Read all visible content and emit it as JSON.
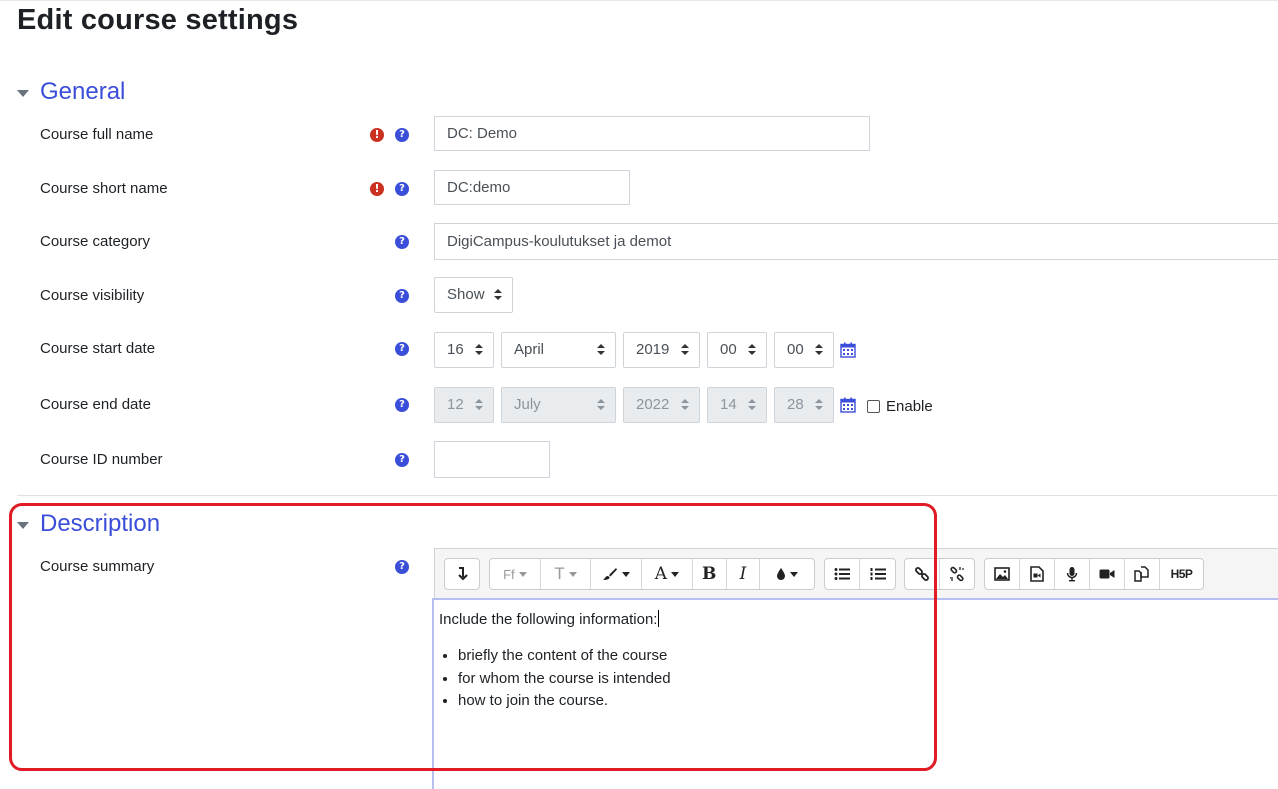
{
  "page_title": "Edit course settings",
  "sections": {
    "general": {
      "title": "General"
    },
    "description": {
      "title": "Description"
    }
  },
  "fields": {
    "full_name": {
      "label": "Course full name",
      "value": "DC: Demo"
    },
    "short_name": {
      "label": "Course short name",
      "value": "DC:demo"
    },
    "category": {
      "label": "Course category",
      "value": "DigiCampus-koulutukset ja demot"
    },
    "visibility": {
      "label": "Course visibility",
      "value": "Show"
    },
    "start_date": {
      "label": "Course start date",
      "day": "16",
      "month": "April",
      "year": "2019",
      "hour": "00",
      "minute": "00"
    },
    "end_date": {
      "label": "Course end date",
      "day": "12",
      "month": "July",
      "year": "2022",
      "hour": "14",
      "minute": "28",
      "enable_label": "Enable",
      "enabled": false
    },
    "id_number": {
      "label": "Course ID number",
      "value": ""
    },
    "summary": {
      "label": "Course summary",
      "intro": "Include the following information:",
      "bullets": [
        "briefly the content of the course",
        "for whom the course is intended",
        "how to join the course."
      ]
    }
  },
  "toolbar": {
    "font_family": "Ff",
    "font_size": "T",
    "font_color": "A",
    "bold": "B",
    "italic": "I",
    "h5p": "H5P"
  },
  "icons": {
    "required": "exclamation-circle-icon",
    "help": "question-circle-icon",
    "calendar": "calendar-icon"
  },
  "colors": {
    "accent": "#3b4ed9",
    "required": "#ca3120",
    "highlight": "#e01b24"
  }
}
